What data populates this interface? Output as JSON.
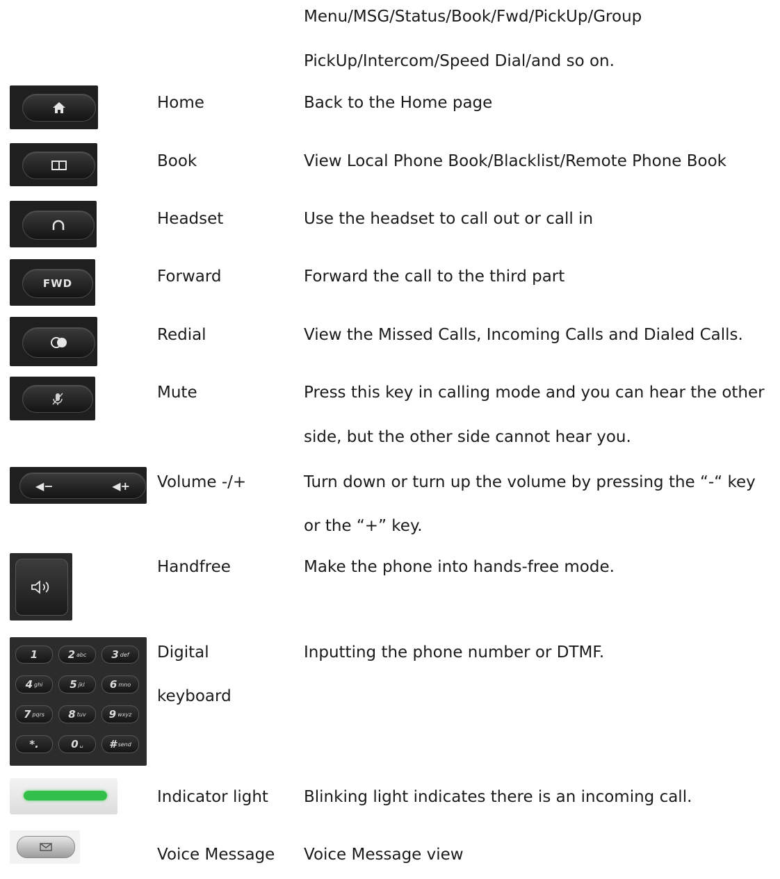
{
  "intro_lines": [
    "Menu/MSG/Status/Book/Fwd/PickUp/Group",
    "PickUp/Intercom/Speed Dial/and so on."
  ],
  "rows": [
    {
      "name": "Home",
      "desc": "Back to the Home page",
      "icon": "home-icon"
    },
    {
      "name": "Book",
      "desc": "View Local Phone Book/Blacklist/Remote Phone Book",
      "icon": "book-icon"
    },
    {
      "name": "Headset",
      "desc": "Use the headset to call out or call in",
      "icon": "headset-icon"
    },
    {
      "name": "Forward",
      "desc": "Forward the call to the third part",
      "icon": "fwd-icon",
      "key_label": "FWD"
    },
    {
      "name": "Redial",
      "desc": "View the Missed Calls, Incoming Calls and Dialed Calls.",
      "icon": "redial-icon"
    },
    {
      "name": "Mute",
      "desc": "Press this key in calling mode and you can hear the other",
      "desc2": "side, but the other side cannot hear you.",
      "icon": "mute-icon"
    },
    {
      "name": "Volume -/+",
      "desc": "Turn down or turn up the volume by pressing the “-“ key",
      "desc2": "or the “+” key.",
      "icon": "volume-icon"
    },
    {
      "name": "Handfree",
      "desc": "Make the phone into hands-free mode.",
      "icon": "speaker-icon"
    },
    {
      "name": "Digital",
      "name2": "keyboard",
      "desc": "Inputting the phone number or DTMF.",
      "icon": "keypad-icon"
    },
    {
      "name": "Indicator light",
      "desc": "Blinking light indicates there is an incoming call.",
      "icon": "indicator-light-icon"
    },
    {
      "name": "Voice Message",
      "desc": "Voice Message view",
      "icon": "voicemail-icon"
    }
  ],
  "keypad": [
    {
      "d": "1",
      "l": ""
    },
    {
      "d": "2",
      "l": "abc"
    },
    {
      "d": "3",
      "l": "def"
    },
    {
      "d": "4",
      "l": "ghi"
    },
    {
      "d": "5",
      "l": "jkl"
    },
    {
      "d": "6",
      "l": "mno"
    },
    {
      "d": "7",
      "l": "pqrs"
    },
    {
      "d": "8",
      "l": "tuv"
    },
    {
      "d": "9",
      "l": "wxyz"
    },
    {
      "d": "*.",
      "l": ""
    },
    {
      "d": "0",
      "l": "␣"
    },
    {
      "d": "#",
      "l": "send"
    }
  ],
  "colors": {
    "indicator_green": "#33c04a",
    "key_dark": "#1f1f1f",
    "text": "#1a1a1a"
  }
}
